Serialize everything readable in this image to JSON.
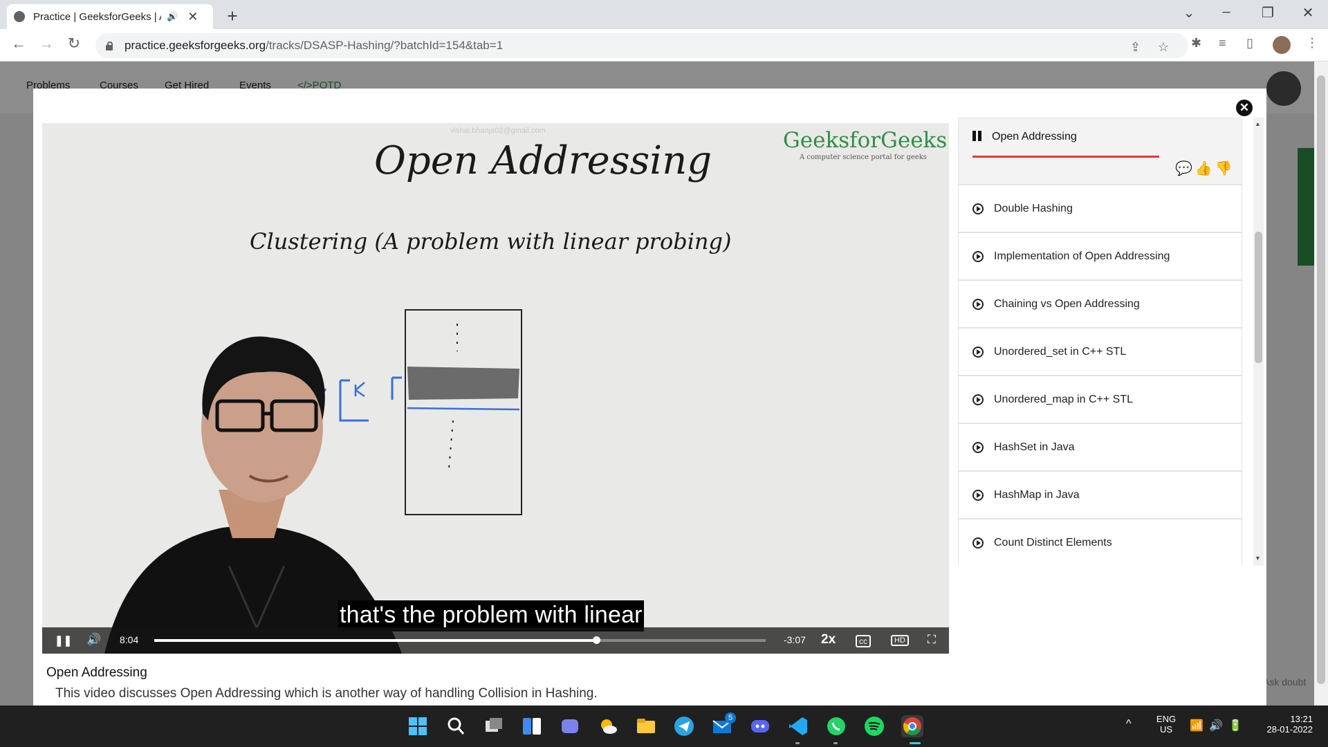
{
  "browser": {
    "tab_title": "Practice | GeeksforGeeks | A",
    "new_tab_glyph": "+",
    "url_host": "practice.geeksforgeeks.org",
    "url_path": "/tracks/DSASP-Hashing/?batchId=154&tab=1",
    "icons": [
      "back-icon",
      "forward-icon",
      "reload-icon",
      "lock-icon",
      "share-icon",
      "star-icon",
      "extensions-icon",
      "reading-list-icon",
      "side-panel-icon",
      "profile-avatar",
      "more-icon"
    ]
  },
  "page_nav": {
    "items": [
      "Problems",
      "Courses",
      "Get Hired",
      "Events",
      "</>POTD"
    ]
  },
  "video": {
    "watermark": "vishal.bhanja02@gmail.com",
    "logo": "GeeksforGeeks",
    "logo_tagline": "A computer science portal for geeks",
    "board_title": "Open Addressing",
    "board_subtitle": "Clustering (A problem with linear probing)",
    "subtitle": "that's the problem with linear",
    "elapsed": "8:04",
    "remaining": "-3:07",
    "speed": "2x",
    "progress_fraction": 0.723,
    "buffer_fraction": 0.745
  },
  "video_info": {
    "title": "Open Addressing",
    "description": "This video discusses Open Addressing which is another way of handling Collision in Hashing."
  },
  "playlist": {
    "current": "Open Addressing",
    "items": [
      "Double Hashing",
      "Implementation of Open Addressing",
      "Chaining vs Open Addressing",
      "Unordered_set in C++ STL",
      "Unordered_map in C++ STL",
      "HashSet in Java",
      "HashMap in Java",
      "Count Distinct Elements"
    ]
  },
  "background": {
    "ask_doubt": "Ask doubt"
  },
  "taskbar": {
    "lang_top": "ENG",
    "lang_bottom": "US",
    "time": "13:21",
    "date": "28-01-2022",
    "mail_badge": "5"
  }
}
